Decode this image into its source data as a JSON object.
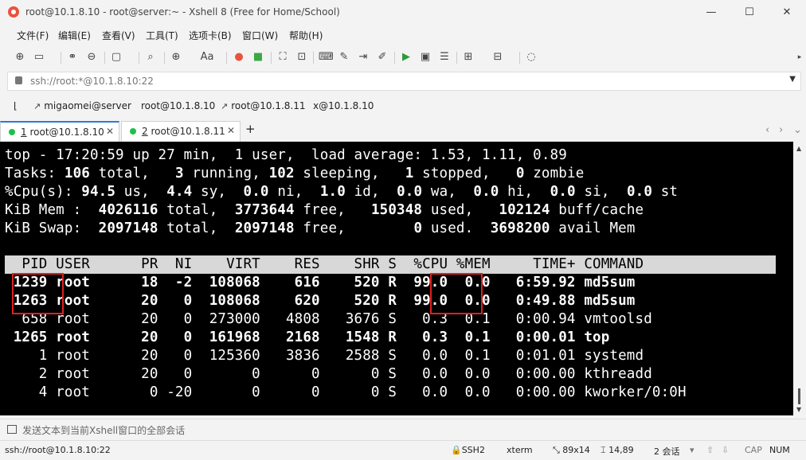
{
  "window": {
    "title": "root@10.1.8.10 - root@server:~ - Xshell 8 (Free for Home/School)",
    "minimize": "—",
    "maximize": "☐",
    "close": "✕"
  },
  "menu": [
    "文件(F)",
    "编辑(E)",
    "查看(V)",
    "工具(T)",
    "选项卡(B)",
    "窗口(W)",
    "帮助(H)"
  ],
  "toolbar": {
    "font_label": "Aa"
  },
  "address": {
    "value": "ssh://root:*@10.1.8.10:22",
    "dropdown": "▼"
  },
  "links": [
    "migaomei@server",
    "root@10.1.8.10",
    "root@10.1.8.11",
    "x@10.1.8.10"
  ],
  "tabs": [
    {
      "num": "1",
      "label": "root@10.1.8.10",
      "close": "✕"
    },
    {
      "num": "2",
      "label": "root@10.1.8.11",
      "close": "✕"
    }
  ],
  "tab_add": "+",
  "tab_nav": {
    "prev": "‹",
    "next": "›",
    "menu": "⌄"
  },
  "terminal": {
    "summary": {
      "l1": "top - 17:20:59 up 27 min,  1 user,  load average: 1.53, 1.11, 0.89",
      "l2a": "Tasks: ",
      "l2b": "106",
      "l2c": " total,   ",
      "l2d": "3",
      "l2e": " running, ",
      "l2f": "102",
      "l2g": " sleeping,   ",
      "l2h": "1",
      "l2i": " stopped,   ",
      "l2j": "0",
      "l2k": " zombie",
      "l3a": "%Cpu(s): ",
      "l3b": "94.5",
      "l3c": " us,  ",
      "l3d": "4.4",
      "l3e": " sy,  ",
      "l3f": "0.0",
      "l3g": " ni,  ",
      "l3h": "1.0",
      "l3i": " id,  ",
      "l3j": "0.0",
      "l3k": " wa,  ",
      "l3l": "0.0",
      "l3m": " hi,  ",
      "l3n": "0.0",
      "l3o": " si,  ",
      "l3p": "0.0",
      "l3q": " st",
      "l4a": "KiB Mem : ",
      "l4b": " 4026116",
      "l4c": " total,  ",
      "l4d": "3773644",
      "l4e": " free,   ",
      "l4f": "150348",
      "l4g": " used,   ",
      "l4h": "102124",
      "l4i": " buff/cache",
      "l5a": "KiB Swap: ",
      "l5b": " 2097148",
      "l5c": " total,  ",
      "l5d": "2097148",
      "l5e": " free,        ",
      "l5f": "0",
      "l5g": " used.  ",
      "l5h": "3698200",
      "l5i": " avail Mem"
    },
    "header": "  PID USER      PR  NI    VIRT    RES    SHR S  %CPU %MEM     TIME+ COMMAND",
    "processes": [
      {
        "text": " 1239 root      18  -2  108068    616    520 R  99.0  0.0   6:59.92 md5sum",
        "bold": true
      },
      {
        "text": " 1263 root      20   0  108068    620    520 R  99.0  0.0   0:49.88 md5sum",
        "bold": true
      },
      {
        "text": "  658 root      20   0  273000   4808   3676 S   0.3  0.1   0:00.94 vmtoolsd",
        "bold": false
      },
      {
        "text": " 1265 root      20   0  161968   2168   1548 R   0.3  0.1   0:00.01 top",
        "bold": true
      },
      {
        "text": "    1 root      20   0  125360   3836   2588 S   0.0  0.1   0:01.01 systemd",
        "bold": false
      },
      {
        "text": "    2 root      20   0       0      0      0 S   0.0  0.0   0:00.00 kthreadd",
        "bold": false
      },
      {
        "text": "    4 root       0 -20       0      0      0 S   0.0  0.0   0:00.00 kworker/0:0H",
        "bold": false
      }
    ]
  },
  "compose": {
    "placeholder": "发送文本到当前Xshell窗口的全部会话"
  },
  "status": {
    "connection": "ssh://root@10.1.8.10:22",
    "protocol": "SSH2",
    "term": "xterm",
    "size": "89x14",
    "cursor": "14,89",
    "sessions": "2 会话",
    "caps": "CAP",
    "num": "NUM"
  },
  "colors": {
    "tab_active_border": "#2d7ad6",
    "dot_green": "#1ec04a",
    "highlight_red": "#e02020",
    "terminal_bg": "#000000"
  }
}
